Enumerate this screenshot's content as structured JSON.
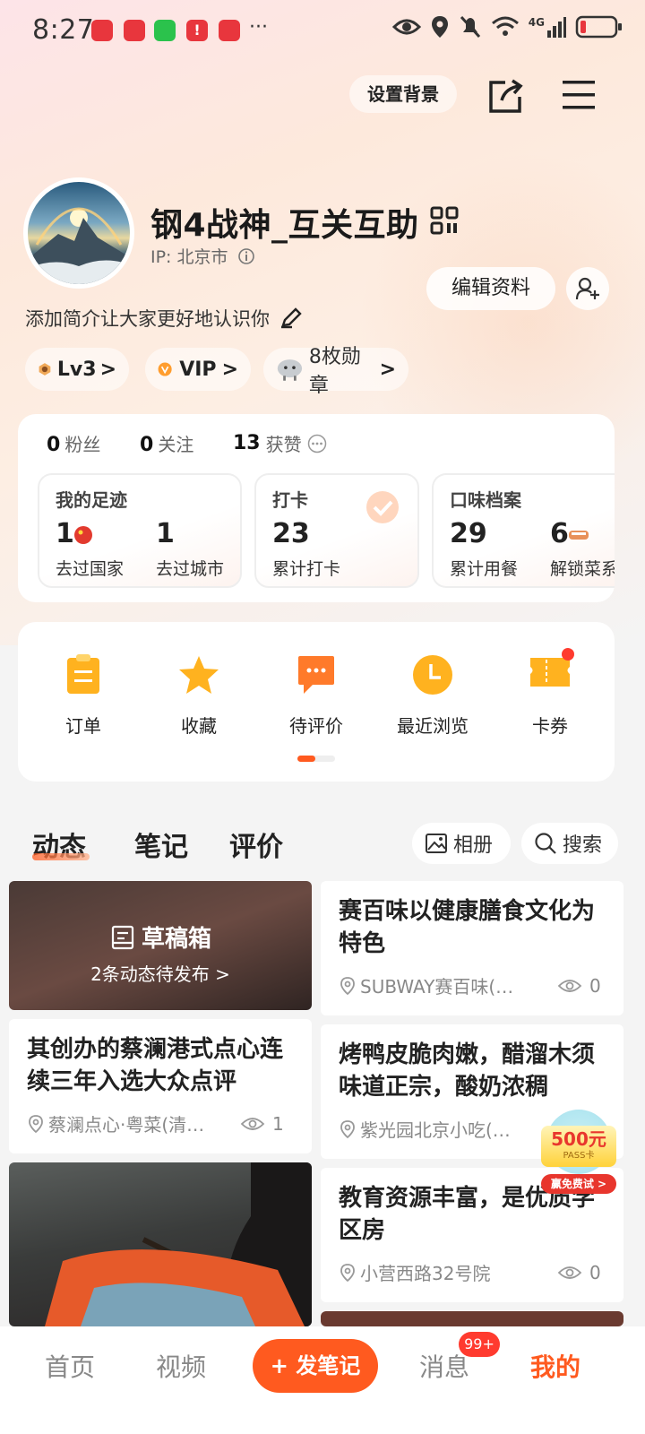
{
  "status_bar": {
    "time": "8:27",
    "more": "···",
    "network": "4G"
  },
  "header": {
    "set_background": "设置背景"
  },
  "profile": {
    "username": "钢4战神_互关互助",
    "ip": "IP: 北京市",
    "edit_button": "编辑资料",
    "intro": "添加简介让大家更好地认识你",
    "level": "Lv3",
    "vip": "VIP",
    "badges": "8枚勋章"
  },
  "stats": {
    "followers_num": "0",
    "followers_label": "粉丝",
    "following_num": "0",
    "following_label": "关注",
    "likes_num": "13",
    "likes_label": "获赞"
  },
  "cards": {
    "footprint": {
      "title": "我的足迹",
      "countries_num": "1",
      "countries_label": "去过国家",
      "cities_num": "1",
      "cities_label": "去过城市"
    },
    "checkin": {
      "title": "打卡",
      "num": "23",
      "label": "累计打卡"
    },
    "taste": {
      "title": "口味档案",
      "meals_num": "29",
      "meals_label": "累计用餐",
      "dishes_num": "6",
      "dishes_label": "解锁菜系"
    }
  },
  "services": [
    {
      "label": "订单",
      "icon": "order-icon"
    },
    {
      "label": "收藏",
      "icon": "star-icon"
    },
    {
      "label": "待评价",
      "icon": "comment-icon"
    },
    {
      "label": "最近浏览",
      "icon": "clock-icon"
    },
    {
      "label": "卡券",
      "icon": "ticket-icon"
    }
  ],
  "feed_tabs": [
    "动态",
    "笔记",
    "评价"
  ],
  "feed_actions": {
    "album": "相册",
    "search": "搜索"
  },
  "drafts": {
    "title": "草稿箱",
    "subtitle": "2条动态待发布"
  },
  "posts": [
    {
      "title": "赛百味以健康膳食文化为特色",
      "place": "SUBWAY赛百味(…",
      "views": "0"
    },
    {
      "title": "其创办的蔡澜港式点心连续三年入选大众点评",
      "place": "蔡澜点心·粤菜(清…",
      "views": "1"
    },
    {
      "title": "烤鸭皮脆肉嫩，醋溜木须味道正宗，酸奶浓稠",
      "place": "紫光园北京小吃(…"
    },
    {
      "title": "教育资源丰富，是优质学区房",
      "place": "小营西路32号院",
      "views": "0"
    }
  ],
  "promo": {
    "amount": "500元",
    "card": "PASS卡",
    "cta": "赢免费试 >"
  },
  "nav": {
    "home": "首页",
    "video": "视频",
    "post": "+ 发笔记",
    "messages": "消息",
    "messages_badge": "99+",
    "me": "我的"
  },
  "colors": {
    "accent": "#ff5a1f",
    "service_yellow": "#ffb21f",
    "service_orange": "#ff7a2a"
  }
}
